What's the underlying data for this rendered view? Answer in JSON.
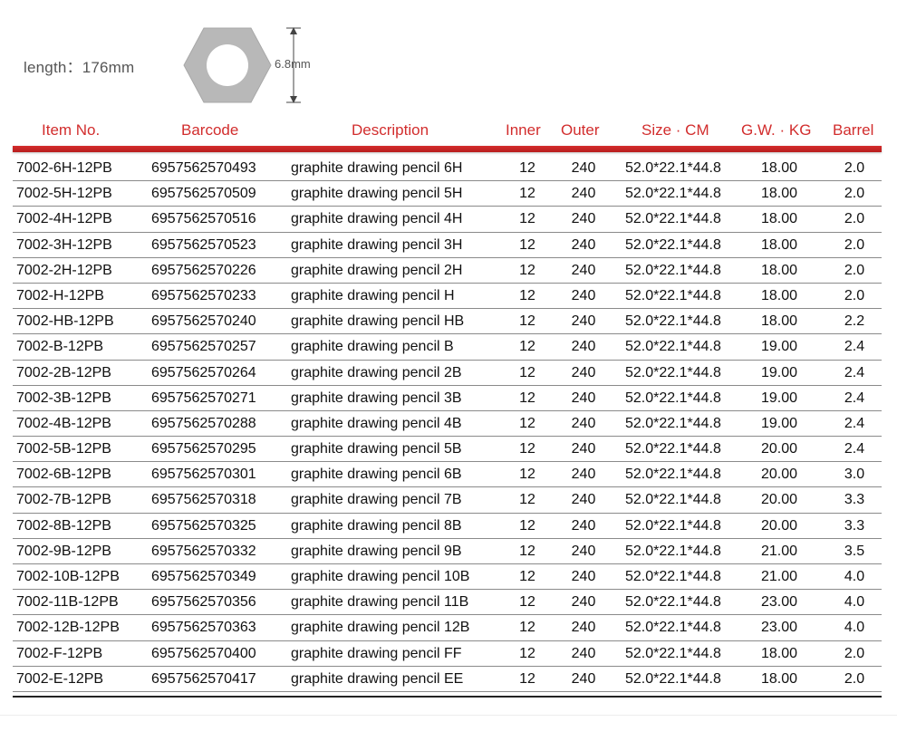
{
  "spec": {
    "length_label": "length：176mm",
    "width_label": "6.8mm"
  },
  "table": {
    "headers": [
      "Item No.",
      "Barcode",
      "Description",
      "Inner",
      "Outer",
      "Size · CM",
      "G.W. · KG",
      "Barrel"
    ],
    "rows": [
      [
        "7002-6H-12PB",
        "6957562570493",
        "graphite drawing pencil 6H",
        "12",
        "240",
        "52.0*22.1*44.8",
        "18.00",
        "2.0"
      ],
      [
        "7002-5H-12PB",
        "6957562570509",
        "graphite drawing pencil 5H",
        "12",
        "240",
        "52.0*22.1*44.8",
        "18.00",
        "2.0"
      ],
      [
        "7002-4H-12PB",
        "6957562570516",
        "graphite drawing pencil 4H",
        "12",
        "240",
        "52.0*22.1*44.8",
        "18.00",
        "2.0"
      ],
      [
        "7002-3H-12PB",
        "6957562570523",
        "graphite drawing pencil 3H",
        "12",
        "240",
        "52.0*22.1*44.8",
        "18.00",
        "2.0"
      ],
      [
        "7002-2H-12PB",
        "6957562570226",
        "graphite drawing pencil 2H",
        "12",
        "240",
        "52.0*22.1*44.8",
        "18.00",
        "2.0"
      ],
      [
        "7002-H-12PB",
        "6957562570233",
        "graphite drawing pencil H",
        "12",
        "240",
        "52.0*22.1*44.8",
        "18.00",
        "2.0"
      ],
      [
        "7002-HB-12PB",
        "6957562570240",
        "graphite drawing pencil HB",
        "12",
        "240",
        "52.0*22.1*44.8",
        "18.00",
        "2.2"
      ],
      [
        "7002-B-12PB",
        "6957562570257",
        "graphite drawing pencil B",
        "12",
        "240",
        "52.0*22.1*44.8",
        "19.00",
        "2.4"
      ],
      [
        "7002-2B-12PB",
        "6957562570264",
        "graphite drawing pencil 2B",
        "12",
        "240",
        "52.0*22.1*44.8",
        "19.00",
        "2.4"
      ],
      [
        "7002-3B-12PB",
        "6957562570271",
        "graphite drawing pencil 3B",
        "12",
        "240",
        "52.0*22.1*44.8",
        "19.00",
        "2.4"
      ],
      [
        "7002-4B-12PB",
        "6957562570288",
        "graphite drawing pencil 4B",
        "12",
        "240",
        "52.0*22.1*44.8",
        "19.00",
        "2.4"
      ],
      [
        "7002-5B-12PB",
        "6957562570295",
        "graphite drawing pencil 5B",
        "12",
        "240",
        "52.0*22.1*44.8",
        "20.00",
        "2.4"
      ],
      [
        "7002-6B-12PB",
        "6957562570301",
        "graphite drawing pencil 6B",
        "12",
        "240",
        "52.0*22.1*44.8",
        "20.00",
        "3.0"
      ],
      [
        "7002-7B-12PB",
        "6957562570318",
        "graphite drawing pencil 7B",
        "12",
        "240",
        "52.0*22.1*44.8",
        "20.00",
        "3.3"
      ],
      [
        "7002-8B-12PB",
        "6957562570325",
        "graphite drawing pencil 8B",
        "12",
        "240",
        "52.0*22.1*44.8",
        "20.00",
        "3.3"
      ],
      [
        "7002-9B-12PB",
        "6957562570332",
        "graphite drawing pencil 9B",
        "12",
        "240",
        "52.0*22.1*44.8",
        "21.00",
        "3.5"
      ],
      [
        "7002-10B-12PB",
        "6957562570349",
        "graphite drawing pencil 10B",
        "12",
        "240",
        "52.0*22.1*44.8",
        "21.00",
        "4.0"
      ],
      [
        "7002-11B-12PB",
        "6957562570356",
        "graphite drawing pencil 11B",
        "12",
        "240",
        "52.0*22.1*44.8",
        "23.00",
        "4.0"
      ],
      [
        "7002-12B-12PB",
        "6957562570363",
        "graphite drawing pencil 12B",
        "12",
        "240",
        "52.0*22.1*44.8",
        "23.00",
        "4.0"
      ],
      [
        "7002-F-12PB",
        "6957562570400",
        "graphite drawing pencil FF",
        "12",
        "240",
        "52.0*22.1*44.8",
        "18.00",
        "2.0"
      ],
      [
        "7002-E-12PB",
        "6957562570417",
        "graphite drawing pencil EE",
        "12",
        "240",
        "52.0*22.1*44.8",
        "18.00",
        "2.0"
      ]
    ]
  },
  "colors": {
    "header_text": "#d22d2d",
    "rule": "#c42424",
    "hex_fill": "#b8b8b8",
    "body_text": "#111111"
  },
  "icons": {
    "hex_cross_section": "hexagon-pencil-cross-section-icon"
  }
}
